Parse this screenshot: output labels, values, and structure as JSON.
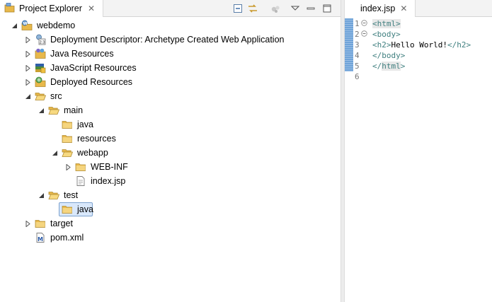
{
  "project_explorer": {
    "tab_label": "Project Explorer",
    "close_glyph": "✕",
    "toolbar": [
      "collapse-all-icon",
      "link-with-editor-icon",
      "focus-icon",
      "view-menu-icon",
      "minimize-icon",
      "maximize-icon"
    ],
    "tree": [
      {
        "label": "webdemo",
        "depth": 0,
        "twisty": "expanded",
        "icon": "web-project-icon"
      },
      {
        "label": "Deployment Descriptor: Archetype Created Web Application",
        "depth": 1,
        "twisty": "collapsed",
        "icon": "deployment-descriptor-icon"
      },
      {
        "label": "Java Resources",
        "depth": 1,
        "twisty": "collapsed",
        "icon": "java-resources-icon"
      },
      {
        "label": "JavaScript Resources",
        "depth": 1,
        "twisty": "collapsed",
        "icon": "javascript-resources-icon"
      },
      {
        "label": "Deployed Resources",
        "depth": 1,
        "twisty": "collapsed",
        "icon": "deployed-resources-icon"
      },
      {
        "label": "src",
        "depth": 1,
        "twisty": "expanded",
        "icon": "folder-open-icon"
      },
      {
        "label": "main",
        "depth": 2,
        "twisty": "expanded",
        "icon": "folder-open-icon"
      },
      {
        "label": "java",
        "depth": 3,
        "twisty": "none",
        "icon": "folder-icon"
      },
      {
        "label": "resources",
        "depth": 3,
        "twisty": "none",
        "icon": "folder-icon"
      },
      {
        "label": "webapp",
        "depth": 3,
        "twisty": "expanded",
        "icon": "folder-open-icon"
      },
      {
        "label": "WEB-INF",
        "depth": 4,
        "twisty": "collapsed",
        "icon": "folder-icon"
      },
      {
        "label": "index.jsp",
        "depth": 4,
        "twisty": "none",
        "icon": "file-icon"
      },
      {
        "label": "test",
        "depth": 2,
        "twisty": "expanded",
        "icon": "folder-open-icon"
      },
      {
        "label": "java",
        "depth": 3,
        "twisty": "none",
        "icon": "folder-icon",
        "selected": true
      },
      {
        "label": "target",
        "depth": 1,
        "twisty": "collapsed",
        "icon": "folder-icon"
      },
      {
        "label": "pom.xml",
        "depth": 1,
        "twisty": "none",
        "icon": "maven-file-icon"
      }
    ]
  },
  "editor": {
    "tab_label": "index.jsp",
    "close_glyph": "✕",
    "lines": [
      {
        "num": "1",
        "fold": true,
        "parts": [
          {
            "t": "<html>",
            "c": "tag hl"
          }
        ]
      },
      {
        "num": "2",
        "fold": true,
        "parts": [
          {
            "t": "<body>",
            "c": "tag"
          }
        ]
      },
      {
        "num": "3",
        "fold": false,
        "parts": [
          {
            "t": "<h2>",
            "c": "tag"
          },
          {
            "t": "Hello World!",
            "c": "txt"
          },
          {
            "t": "</h2>",
            "c": "tag"
          }
        ]
      },
      {
        "num": "4",
        "fold": false,
        "parts": [
          {
            "t": "</body>",
            "c": "tag"
          }
        ]
      },
      {
        "num": "5",
        "fold": false,
        "parts": [
          {
            "t": "</",
            "c": "tag"
          },
          {
            "t": "html",
            "c": "tag hl"
          },
          {
            "t": ">",
            "c": "tag"
          }
        ]
      },
      {
        "num": "6",
        "fold": false,
        "parts": []
      }
    ]
  },
  "colors": {
    "folder": "#e8b84a",
    "selection_bg": "#d9e8fb",
    "selection_border": "#7da2ce",
    "tag": "#3f7f7f",
    "ruler": "#6fa3d8"
  }
}
